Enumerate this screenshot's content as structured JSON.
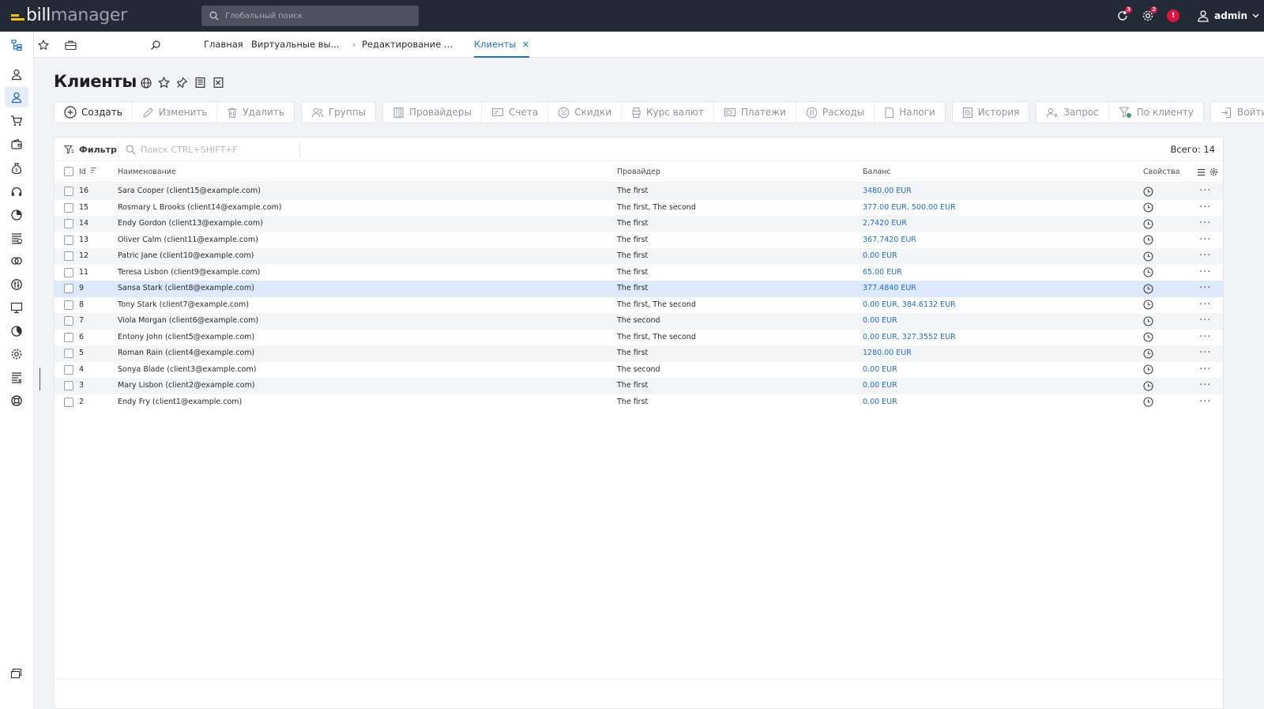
{
  "app": {
    "logo_primary": "bill",
    "logo_secondary": "manager",
    "search_placeholder": "Глобальный поиск",
    "notifications": [
      {
        "icon": "sync-icon",
        "count": "3"
      },
      {
        "icon": "gear-icon",
        "count": "2"
      },
      {
        "icon": "alert-icon",
        "count": "!"
      }
    ],
    "user": "admin"
  },
  "tabs": {
    "items": [
      {
        "label": "Главная"
      },
      {
        "label": "Виртуальные вы..."
      },
      {
        "label": "Редактирование ..."
      },
      {
        "label": "Клиенты"
      }
    ],
    "separator": "›",
    "close_glyph": "×"
  },
  "page": {
    "title": "Клиенты",
    "title_icons": [
      "globe-icon",
      "star-icon",
      "pin-icon",
      "notes-icon",
      "export-icon"
    ]
  },
  "toolbar": {
    "groups": [
      [
        {
          "label": "Создать",
          "icon": "plus-circle-icon",
          "enabled": true
        },
        {
          "label": "Изменить",
          "icon": "pencil-icon",
          "enabled": false
        },
        {
          "label": "Удалить",
          "icon": "trash-icon",
          "enabled": false
        }
      ],
      [
        {
          "label": "Группы",
          "icon": "group-icon",
          "enabled": false
        }
      ],
      [
        {
          "label": "Провайдеры",
          "icon": "building-icon",
          "enabled": false
        },
        {
          "label": "Счета",
          "icon": "invoice-icon",
          "enabled": false
        },
        {
          "label": "Скидки",
          "icon": "percent-icon",
          "enabled": false
        },
        {
          "label": "Курс валют",
          "icon": "currency-icon",
          "enabled": false
        },
        {
          "label": "Платежи",
          "icon": "payment-icon",
          "enabled": false
        },
        {
          "label": "Расходы",
          "icon": "expense-icon",
          "enabled": false
        },
        {
          "label": "Налоги",
          "icon": "tax-icon",
          "enabled": false
        }
      ],
      [
        {
          "label": "История",
          "icon": "history-icon",
          "enabled": false
        }
      ],
      [
        {
          "label": "Запрос",
          "icon": "request-icon",
          "enabled": false
        },
        {
          "label": "По клиенту",
          "icon": "filter-client-icon",
          "enabled": false
        }
      ],
      [
        {
          "label": "Войти",
          "icon": "login-icon",
          "enabled": false
        }
      ]
    ]
  },
  "table": {
    "filter_label": "Фильтр",
    "search_placeholder": "Поиск CTRL+SHIFT+F",
    "total_label": "Всего: 14",
    "columns": {
      "id": "Id",
      "name": "Наименование",
      "provider": "Провайдер",
      "balance": "Баланс",
      "props": "Свойства"
    },
    "more_glyph": "···",
    "rows": [
      {
        "id": "16",
        "name": "Sara Cooper (client15@example.com)",
        "provider": "The first",
        "balance": "3480.00 EUR"
      },
      {
        "id": "15",
        "name": "Rosmary L Brooks (client14@example.com)",
        "provider": "The first, The second",
        "balance": "377.00 EUR, 500.00 EUR"
      },
      {
        "id": "14",
        "name": "Endy Gordon (client13@example.com)",
        "provider": "The first",
        "balance": "2.7420 EUR"
      },
      {
        "id": "13",
        "name": "Oliver Calm (client11@example.com)",
        "provider": "The first",
        "balance": "367.7420 EUR"
      },
      {
        "id": "12",
        "name": "Patric Jane (client10@example.com)",
        "provider": "The first",
        "balance": "0.00 EUR"
      },
      {
        "id": "11",
        "name": "Teresa Lisbon (client9@example.com)",
        "provider": "The first",
        "balance": "65.00 EUR"
      },
      {
        "id": "9",
        "name": "Sansa Stark (client8@example.com)",
        "provider": "The first",
        "balance": "377.4840 EUR",
        "selected": true
      },
      {
        "id": "8",
        "name": "Tony Stark (client7@example.com)",
        "provider": "The first, The second",
        "balance": "0.00 EUR, 384.6132 EUR"
      },
      {
        "id": "7",
        "name": "Viola Morgan (client6@example.com)",
        "provider": "The second",
        "balance": "0.00 EUR"
      },
      {
        "id": "6",
        "name": "Entony John (client5@example.com)",
        "provider": "The first, The second",
        "balance": "0.00 EUR, 327.3552 EUR"
      },
      {
        "id": "5",
        "name": "Roman Rain (client4@example.com)",
        "provider": "The first",
        "balance": "1280.00 EUR"
      },
      {
        "id": "4",
        "name": "Sonya Blade (client3@example.com)",
        "provider": "The second",
        "balance": "0.00 EUR"
      },
      {
        "id": "3",
        "name": "Mary Lisbon (client2@example.com)",
        "provider": "The first",
        "balance": "0.00 EUR"
      },
      {
        "id": "2",
        "name": "Endy Fry (client1@example.com)",
        "provider": "The first",
        "balance": "0.00 EUR"
      }
    ]
  },
  "rail": {
    "items": [
      "tree-icon",
      "star-icon",
      "briefcase-icon",
      "search-icon"
    ],
    "menu": [
      "user-icon",
      "clients-icon",
      "cart-icon",
      "wallet-icon",
      "money-bag-icon",
      "support-icon",
      "chart-icon",
      "server-icon",
      "rings-icon",
      "tools-icon",
      "monitor-icon",
      "pie-icon",
      "settings-icon",
      "server-list-icon",
      "lifebuoy-icon",
      "windows-icon"
    ]
  },
  "colors": {
    "topbar": "#222a36",
    "accent": "#1f6fd1",
    "logo_yellow": "#f5c400",
    "badge": "#e0143c"
  }
}
